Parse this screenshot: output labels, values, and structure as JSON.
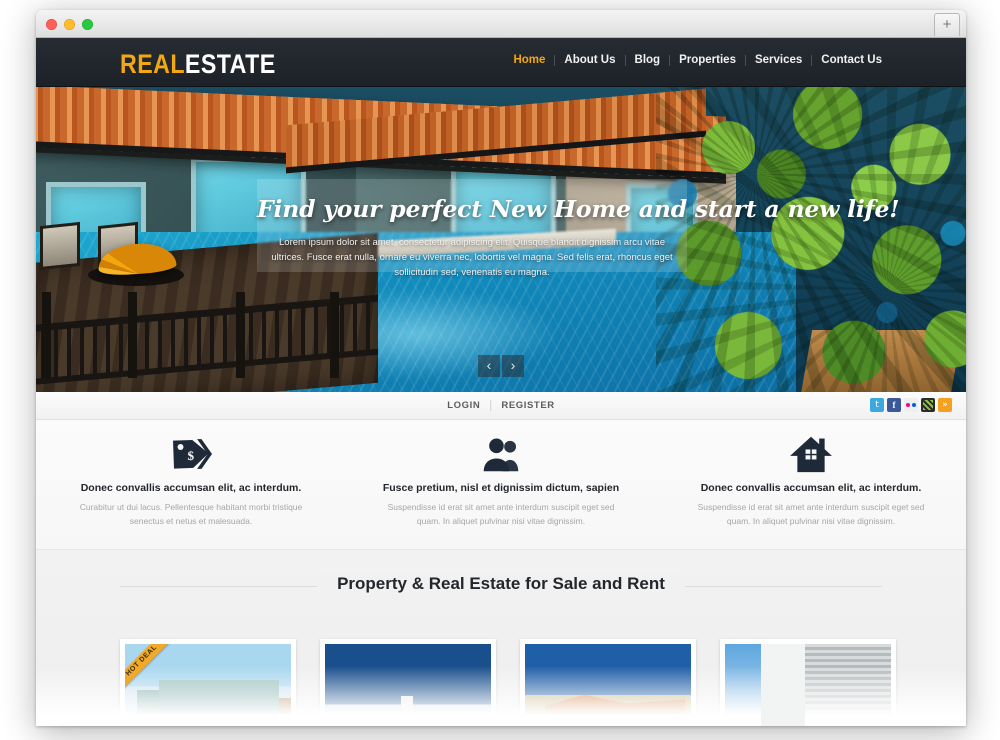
{
  "browser": {
    "controls": {
      "close": "",
      "minimize": "",
      "maximize": ""
    },
    "new_tab_label": "+"
  },
  "site": {
    "logo": {
      "part1": "REAL",
      "part2": "ESTATE",
      "accent_color": "#f2a713"
    },
    "nav": [
      {
        "label": "Home",
        "active": true
      },
      {
        "label": "About Us",
        "active": false
      },
      {
        "label": "Blog",
        "active": false
      },
      {
        "label": "Properties",
        "active": false
      },
      {
        "label": "Services",
        "active": false
      },
      {
        "label": "Contact Us",
        "active": false
      }
    ]
  },
  "hero": {
    "title": "Find your perfect New Home and start a new life!",
    "subtitle": "Lorem ipsum dolor sit amet, consectetur adipiscing elit. Quisque blandit dignissim arcu vitae ultrices. Fusce erat nulla, ornare eu viverra nec, lobortis vel magna. Sed felis erat, rhoncus eget sollicitudin sed, venenatis eu magna.",
    "prev_label": "‹",
    "next_label": "›"
  },
  "account_bar": {
    "login_label": "LOGIN",
    "register_label": "REGISTER",
    "socials": [
      {
        "name": "twitter-icon",
        "glyph": "ᵗ",
        "color": "#3aa9e0"
      },
      {
        "name": "facebook-icon",
        "glyph": "f",
        "color": "#3b5998"
      },
      {
        "name": "flickr-icon",
        "glyph": "",
        "color": "#efefef"
      },
      {
        "name": "dribbble-icon",
        "glyph": "",
        "color": "#2b2b2b"
      },
      {
        "name": "rss-icon",
        "glyph": "◠",
        "color": "#f6a020"
      }
    ]
  },
  "features": [
    {
      "icon": "price-tag-icon",
      "title": "Donec convallis accumsan elit, ac interdum.",
      "text": "Curabitur ut dui lacus. Pellentesque habitant morbi tristique senectus et netus et malesuada."
    },
    {
      "icon": "users-icon",
      "title": "Fusce pretium, nisl et dignissim dictum, sapien",
      "text": "Suspendisse id erat sit amet ante interdum suscipit eget sed quam. In aliquet pulvinar nisi vitae dignissim."
    },
    {
      "icon": "house-icon",
      "title": "Donec convallis accumsan elit, ac interdum.",
      "text": "Suspendisse id erat sit amet ante interdum suscipit eget sed quam. In aliquet pulvinar nisi vitae dignissim."
    }
  ],
  "properties": {
    "section_title": "Property & Real Estate for Sale and Rent",
    "cards": [
      {
        "badge": "HOT DEAL",
        "image": "modern-beach-house-photo"
      },
      {
        "badge": "",
        "image": "white-building-blue-sky-photo"
      },
      {
        "badge": "",
        "image": "terracotta-roof-house-photo"
      },
      {
        "badge": "",
        "image": "grey-siding-modern-house-photo"
      }
    ]
  }
}
